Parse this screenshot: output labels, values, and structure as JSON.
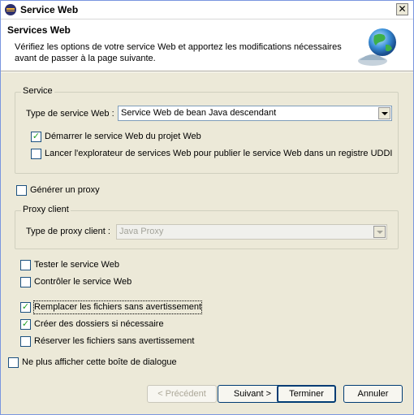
{
  "window": {
    "title": "Service Web"
  },
  "banner": {
    "title": "Services Web",
    "description": "Vérifiez les options de votre service Web et apportez les modifications nécessaires avant de passer à la page suivante."
  },
  "service_group": {
    "legend": "Service",
    "type_label": "Type de service Web :",
    "type_value": "Service Web de bean Java descendant",
    "start_service": {
      "label": "Démarrer le service Web du projet Web",
      "checked": true
    },
    "launch_explorer": {
      "label": "Lancer l'explorateur de services Web pour publier le service Web dans un registre UDDI",
      "checked": false
    }
  },
  "generate_proxy": {
    "label": "Générer un proxy",
    "checked": false
  },
  "proxy_group": {
    "legend": "Proxy client",
    "type_label": "Type de proxy client :",
    "type_value": "Java Proxy"
  },
  "options": {
    "test_service": {
      "label": "Tester le service Web",
      "checked": false
    },
    "monitor_service": {
      "label": "Contrôler le service Web",
      "checked": false
    },
    "overwrite_files": {
      "label": "Remplacer les fichiers sans avertissement",
      "checked": true
    },
    "create_folders": {
      "label": "Créer des dossiers si nécessaire",
      "checked": true
    },
    "checkout_files": {
      "label": "Réserver les fichiers sans avertissement",
      "checked": false
    }
  },
  "dont_show_again": {
    "label": "Ne plus afficher cette boîte de dialogue",
    "checked": false
  },
  "buttons": {
    "back": "< Précédent",
    "next": "Suivant >",
    "finish": "Terminer",
    "cancel": "Annuler"
  },
  "icons": {
    "title": "eclipse-icon",
    "close": "close-icon",
    "banner": "globe-web-service-icon",
    "checkmark": "checkmark-icon",
    "dropdown": "chevron-down-icon"
  },
  "colors": {
    "dialog_bg": "#ece9d8",
    "banner_bg": "#ffffff",
    "check_green": "#21a121",
    "border_blue": "#003c74"
  }
}
